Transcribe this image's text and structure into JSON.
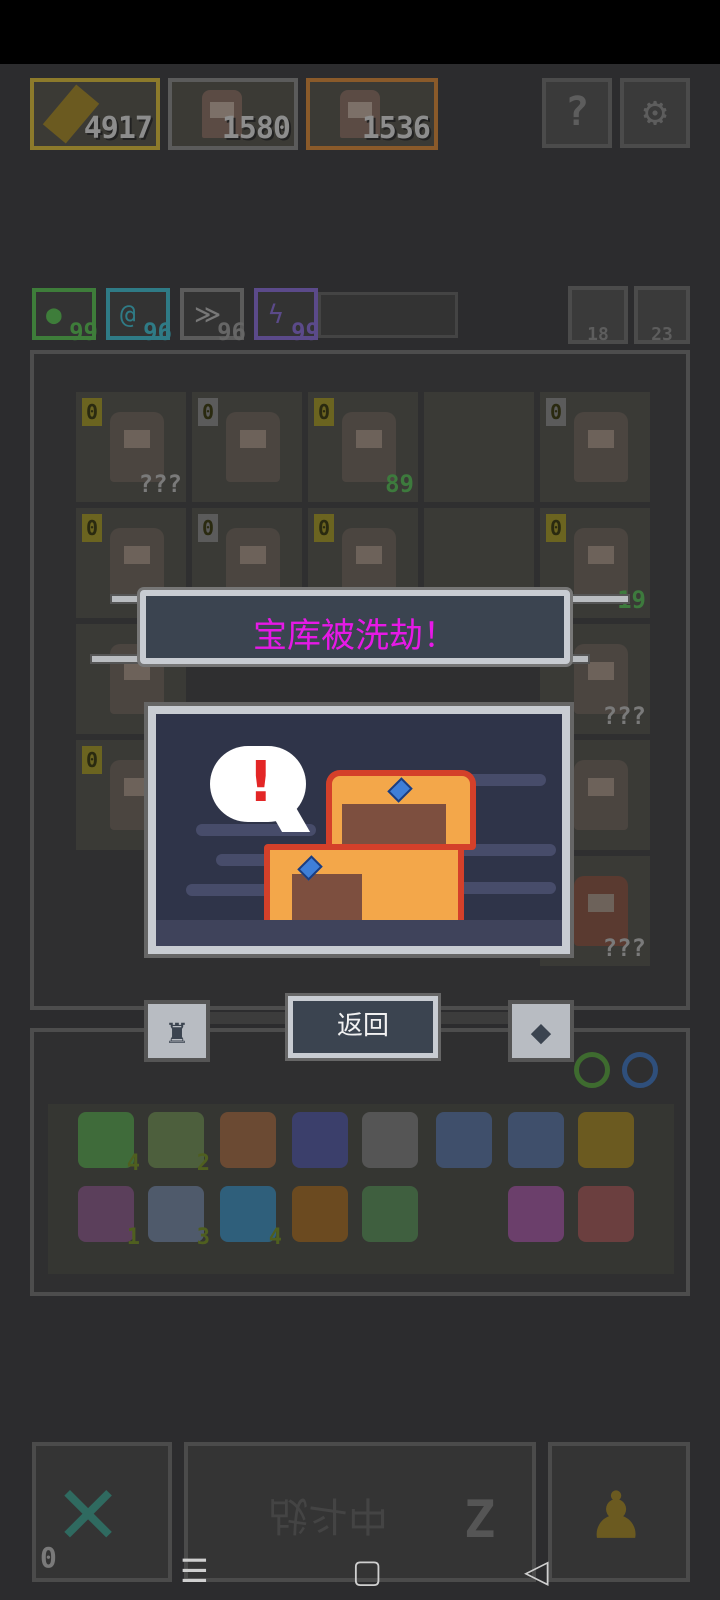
{
  "heroes": [
    {
      "value": "4917",
      "color": "#8c7a2b"
    },
    {
      "value": "1580",
      "color": "#5b5b5b"
    },
    {
      "value": "1536",
      "color": "#8a5a2a"
    }
  ],
  "top_buttons": {
    "help_label": "?",
    "settings_label": "⚙"
  },
  "stats": [
    {
      "value": "99",
      "color": "#3e7d3a",
      "icon": "●"
    },
    {
      "value": "96",
      "color": "#2f7b86",
      "icon": "@"
    },
    {
      "value": "96",
      "color": "#5b5b5b",
      "icon": "≫"
    },
    {
      "value": "99",
      "color": "#5b4a8a",
      "icon": "ϟ"
    }
  ],
  "counters": [
    {
      "value": "18"
    },
    {
      "value": "23"
    }
  ],
  "grid": {
    "cells": [
      {
        "lvl": "0",
        "tag": "???"
      },
      {
        "lvl": "0",
        "tag": ""
      },
      {
        "lvl": "0",
        "tag": "89"
      },
      {
        "lvl": "",
        "tag": ""
      },
      {
        "lvl": "0",
        "tag": ""
      },
      {
        "lvl": "0",
        "tag": ""
      },
      {
        "lvl": "0",
        "tag": ""
      },
      {
        "lvl": "0",
        "tag": ""
      },
      {
        "lvl": "",
        "tag": ""
      },
      {
        "lvl": "0",
        "tag": "19"
      }
    ],
    "right_tags": [
      "???",
      "???"
    ]
  },
  "popup": {
    "title": "宝库被洗劫！",
    "bubble": "!",
    "back_label": "返回"
  },
  "inventory": {
    "row1": [
      {
        "count": "4",
        "color": "#3f6b3a"
      },
      {
        "count": "2",
        "color": "#4d5f3d"
      },
      {
        "count": "",
        "color": "#6b4a33"
      },
      {
        "count": "",
        "color": "#3b3f6b"
      },
      {
        "count": "",
        "color": "#555"
      },
      {
        "count": "",
        "color": "#3f4f6b"
      },
      {
        "count": "",
        "color": "#3f4f6b"
      },
      {
        "count": "",
        "color": "#6b5a20"
      }
    ],
    "row2": [
      {
        "count": "1",
        "color": "#5b3f5b"
      },
      {
        "count": "3",
        "color": "#4f5a6b"
      },
      {
        "count": "4",
        "color": "#2f5f7b"
      },
      {
        "count": "",
        "color": "#6b4a20"
      },
      {
        "count": "",
        "color": "#3f5f3f"
      },
      {
        "count": "",
        "color": "#6b3f6b"
      },
      {
        "count": "",
        "color": "#6b3f3f"
      }
    ]
  },
  "bottom": {
    "left_count": "0",
    "battle_label": "战斗中"
  },
  "navbar": {
    "menu": "☰",
    "home": "▢",
    "back": "◁"
  }
}
